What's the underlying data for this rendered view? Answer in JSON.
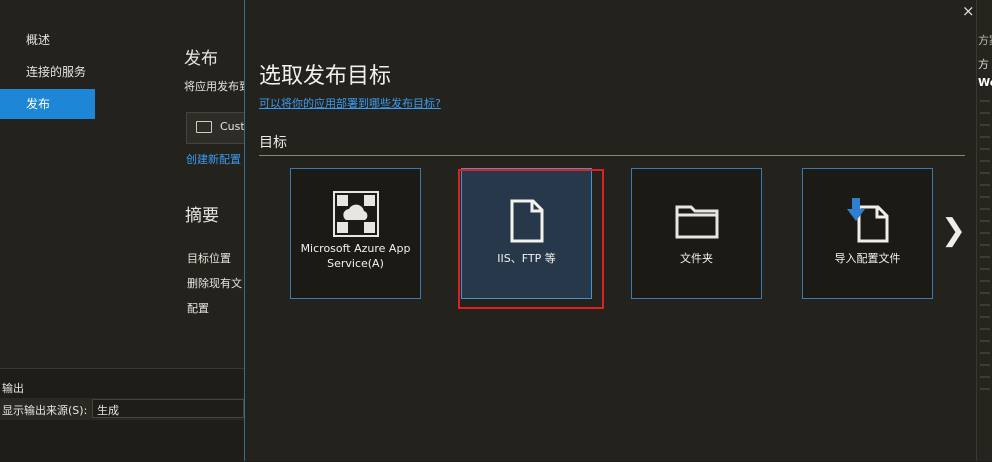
{
  "nav": {
    "items": [
      "概述",
      "连接的服务",
      "发布"
    ],
    "active": "发布"
  },
  "background": {
    "publish_heading": "发布",
    "publish_desc": "将应用发布到",
    "profile_value": "Cust",
    "create_profile_link": "创建新配置",
    "summary_heading": "摘要",
    "summary_items": [
      "目标位置",
      "删除现有文",
      "配置"
    ]
  },
  "output": {
    "title": "输出",
    "source_label": "显示输出来源(S):",
    "source_value": "生成"
  },
  "dialog": {
    "title": "选取发布目标",
    "help_link": "可以将你的应用部署到哪些发布目标?",
    "section_label": "目标",
    "tiles": [
      {
        "label": "Microsoft Azure App Service(A)",
        "icon": "azure-app-service-icon"
      },
      {
        "label": "IIS、FTP 等",
        "icon": "document-icon"
      },
      {
        "label": "文件夹",
        "icon": "folder-icon"
      },
      {
        "label": "导入配置文件",
        "icon": "import-profile-icon"
      }
    ],
    "selected_tile": "IIS、FTP 等",
    "close_glyph": "×",
    "next_glyph": "❯"
  },
  "right_strip": {
    "text_1": "方案",
    "text_2": "方",
    "text_3": "We"
  },
  "colors": {
    "accent": "#1d86d6",
    "tile_border": "#3b79b0",
    "highlight": "#e02020",
    "link": "#3a9bf0"
  }
}
